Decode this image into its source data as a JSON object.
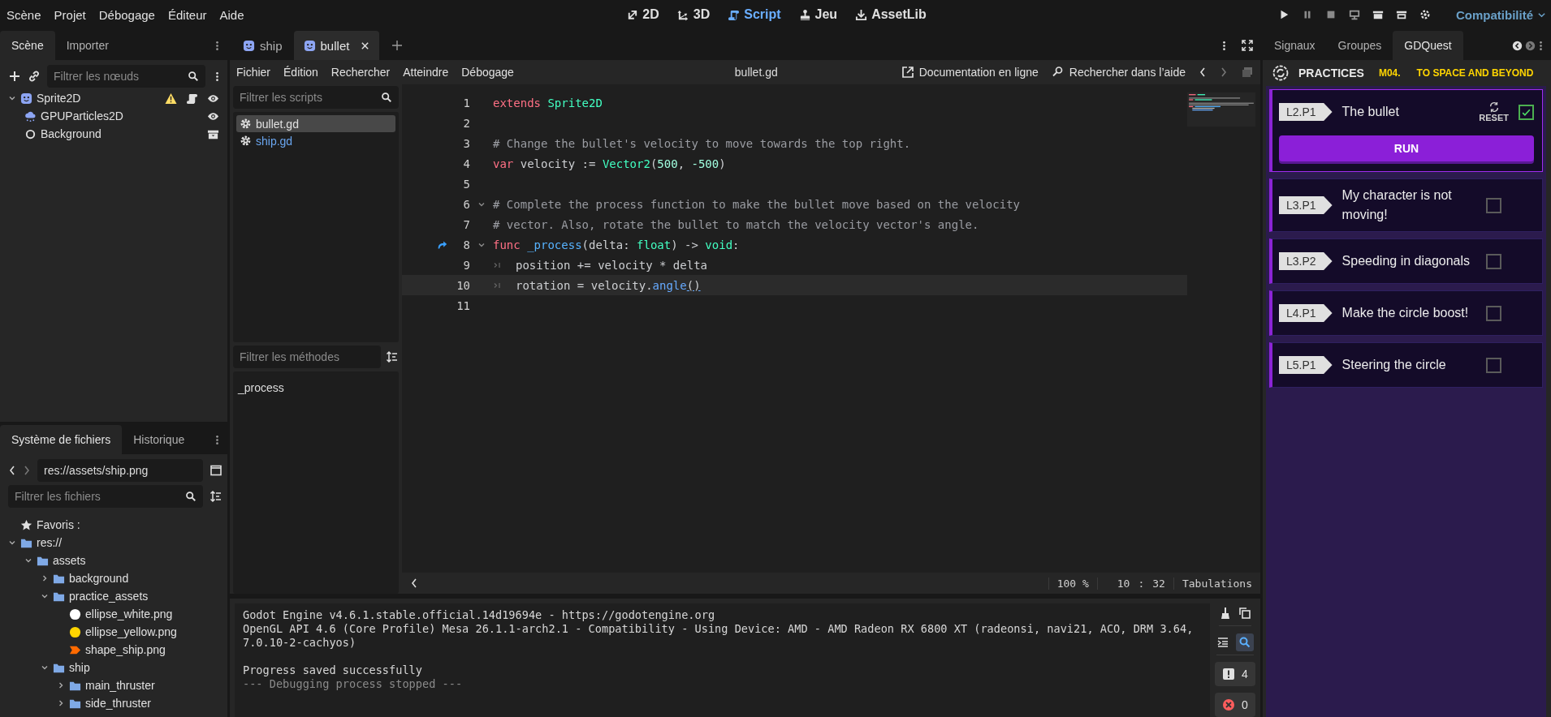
{
  "menu_bar": [
    "Scène",
    "Projet",
    "Débogage",
    "Éditeur",
    "Aide"
  ],
  "workspaces": [
    {
      "label": "2D",
      "selected": false
    },
    {
      "label": "3D",
      "selected": false
    },
    {
      "label": "Script",
      "selected": true
    },
    {
      "label": "Jeu",
      "selected": false
    },
    {
      "label": "AssetLib",
      "selected": false
    }
  ],
  "renderer": "Compatibilité",
  "scene_dock": {
    "tabs": [
      {
        "label": "Scène",
        "selected": true
      },
      {
        "label": "Importer",
        "selected": false
      }
    ],
    "filter": {
      "placeholder": "Filtrer les nœuds"
    },
    "tree": [
      {
        "name": "Sprite2D",
        "kind": "sprite",
        "expanded": true,
        "warning": true,
        "script": true,
        "visible": true,
        "children": [
          {
            "name": "GPUParticles2D",
            "kind": "particles",
            "visible": true
          },
          {
            "name": "Background",
            "kind": "layer"
          }
        ]
      }
    ]
  },
  "filesystem_dock": {
    "tabs": [
      {
        "label": "Système de fichiers",
        "selected": true
      },
      {
        "label": "Historique",
        "selected": false
      }
    ],
    "path": "res://assets/ship.png",
    "filter": {
      "placeholder": "Filtrer les fichiers"
    },
    "tree": [
      {
        "name": "Favoris :",
        "kind": "favorites"
      },
      {
        "name": "res://",
        "kind": "folder",
        "expanded": true,
        "children": [
          {
            "name": "assets",
            "kind": "folder",
            "expanded": true,
            "children": [
              {
                "name": "background",
                "kind": "folder",
                "expanded": false
              },
              {
                "name": "practice_assets",
                "kind": "folder",
                "expanded": true,
                "children": [
                  {
                    "name": "ellipse_white.png",
                    "kind": "circle",
                    "color": "#ffffff"
                  },
                  {
                    "name": "ellipse_yellow.png",
                    "kind": "circle",
                    "color": "#ffd500"
                  },
                  {
                    "name": "shape_ship.png",
                    "kind": "ship",
                    "color": "#ff6a00"
                  }
                ]
              },
              {
                "name": "ship",
                "kind": "folder",
                "expanded": true,
                "children": [
                  {
                    "name": "main_thruster",
                    "kind": "folder",
                    "expanded": false
                  },
                  {
                    "name": "side_thruster",
                    "kind": "folder",
                    "expanded": false
                  }
                ]
              }
            ]
          }
        ]
      }
    ]
  },
  "script_tabs": [
    {
      "label": "ship",
      "selected": false
    },
    {
      "label": "bullet",
      "selected": true
    }
  ],
  "script_menu": [
    "Fichier",
    "Édition",
    "Rechercher",
    "Atteindre",
    "Débogage"
  ],
  "current_file": "bullet.gd",
  "help_links": [
    "Documentation en ligne",
    "Rechercher dans l’aide"
  ],
  "scripts_filter": {
    "placeholder": "Filtrer les scripts"
  },
  "scripts": [
    {
      "name": "bullet.gd",
      "selected": true,
      "color": "#e0e0e0"
    },
    {
      "name": "ship.gd",
      "selected": false,
      "color": "#6aa6f0"
    }
  ],
  "methods_filter": {
    "placeholder": "Filtrer les méthodes"
  },
  "methods": [
    "_process"
  ],
  "code": [
    {
      "number": "1",
      "current": false,
      "tokens": [
        {
          "text": "extends ",
          "kind": "keyword"
        },
        {
          "text": "Sprite2D",
          "kind": "type"
        }
      ]
    },
    {
      "number": "2",
      "current": false
    },
    {
      "number": "3",
      "current": false,
      "tokens": [
        {
          "text": "# Change the bullet's velocity to move towards the top right.",
          "kind": "comment"
        }
      ]
    },
    {
      "number": "4",
      "current": false,
      "tokens": [
        {
          "text": "var",
          "kind": "keyword"
        },
        {
          "text": " velocity := ",
          "kind": "plain"
        },
        {
          "text": "Vector2",
          "kind": "type"
        },
        {
          "text": "(",
          "kind": "plain"
        },
        {
          "text": "500",
          "kind": "number"
        },
        {
          "text": ", ",
          "kind": "plain"
        },
        {
          "text": "-500",
          "kind": "number"
        },
        {
          "text": ")",
          "kind": "plain"
        }
      ]
    },
    {
      "number": "5",
      "current": false
    },
    {
      "number": "6",
      "current": false,
      "folded": false,
      "tokens": [
        {
          "text": "# Complete the process function to make the bullet move based on the velocity",
          "kind": "comment"
        }
      ]
    },
    {
      "number": "7",
      "current": false,
      "tokens": [
        {
          "text": "# vector. Also, rotate the bullet to match the velocity vector's angle.",
          "kind": "comment"
        }
      ]
    },
    {
      "number": "8",
      "current": false,
      "folded": false,
      "marker": true,
      "tokens": [
        {
          "text": "func ",
          "kind": "keyword"
        },
        {
          "text": "_process",
          "kind": "func"
        },
        {
          "text": "(delta: ",
          "kind": "plain"
        },
        {
          "text": "float",
          "kind": "type"
        },
        {
          "text": ") -> ",
          "kind": "plain"
        },
        {
          "text": "void",
          "kind": "type"
        },
        {
          "text": ":",
          "kind": "plain"
        }
      ]
    },
    {
      "number": "9",
      "current": false,
      "tab": true,
      "tokens": [
        {
          "text": "position += velocity * delta",
          "kind": "plain"
        }
      ]
    },
    {
      "number": "10",
      "current": true,
      "tab": true,
      "tokens": [
        {
          "text": "rotation = velocity.",
          "kind": "plain"
        },
        {
          "text": "angle",
          "kind": "call"
        },
        {
          "text": "()",
          "kind": "match"
        }
      ]
    },
    {
      "number": "11",
      "current": false
    }
  ],
  "status": {
    "zoom": "100 %",
    "line": "10",
    "separator": ":",
    "column": "32",
    "indentation": "Tabulations"
  },
  "console": {
    "lines": [
      {
        "text": "Godot Engine v4.6.1.stable.official.14d19694e - https://godotengine.org",
        "kind": "info"
      },
      {
        "text": "OpenGL API 4.6 (Core Profile) Mesa 26.1.1-arch2.1 - Compatibility - Using Device: AMD - AMD Radeon RX 6800 XT (radeonsi, navi21, ACO, DRM 3.64, 7.0.10-2-cachyos)",
        "kind": "info"
      },
      {
        "text": "Progress saved successfully",
        "kind": "info",
        "gap_before": true
      },
      {
        "text": "--- Debugging process stopped ---",
        "kind": "dim"
      }
    ],
    "warnings": "4",
    "errors": "0"
  },
  "right_dock": {
    "tabs": [
      {
        "label": "Signaux",
        "selected": false
      },
      {
        "label": "Groupes",
        "selected": false
      },
      {
        "label": "GDQuest",
        "selected": true
      }
    ]
  },
  "practices": {
    "title": "PRACTICES",
    "module": "M04.",
    "module_title": "TO SPACE AND BEYOND",
    "reset_label": "RESET",
    "run_label": "RUN",
    "items": [
      {
        "code": "L2.P1",
        "title": "The bullet",
        "selected": true,
        "checked": true
      },
      {
        "code": "L3.P1",
        "title": "My character is not moving!",
        "selected": false,
        "checked": false
      },
      {
        "code": "L3.P2",
        "title": "Speeding in diagonals",
        "selected": false,
        "checked": false
      },
      {
        "code": "L4.P1",
        "title": "Make the circle boost!",
        "selected": false,
        "checked": false
      },
      {
        "code": "L5.P1",
        "title": "Steering the circle",
        "selected": false,
        "checked": false
      }
    ]
  }
}
